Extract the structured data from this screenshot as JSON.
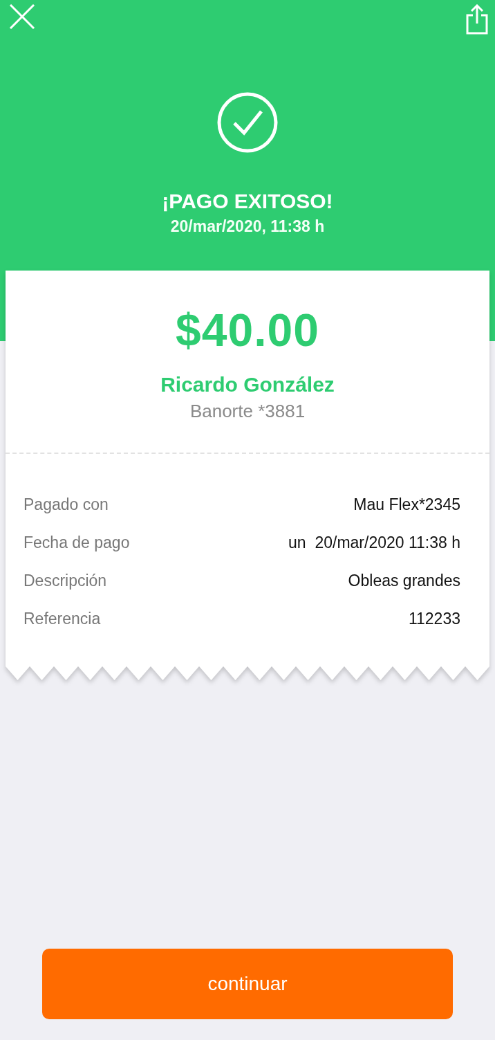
{
  "header": {
    "title": "¡PAGO EXITOSO!",
    "datetime": "20/mar/2020, 11:38 h"
  },
  "receipt": {
    "amount": "$40.00",
    "recipient": "Ricardo González",
    "account": "Banorte *3881",
    "details": [
      {
        "label": "Pagado con",
        "value": "Mau Flex*2345"
      },
      {
        "label": "Fecha de pago",
        "value": "un  20/mar/2020 11:38 h"
      },
      {
        "label": "Descripción",
        "value": "Obleas grandes"
      },
      {
        "label": "Referencia",
        "value": "112233"
      }
    ]
  },
  "button": {
    "label": "continuar"
  }
}
